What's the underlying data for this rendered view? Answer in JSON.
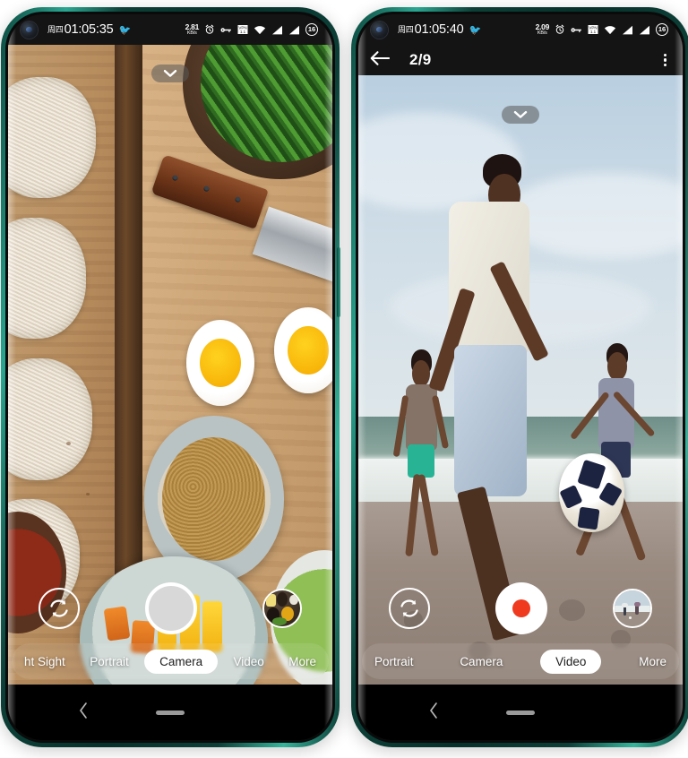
{
  "left_phone": {
    "status_bar": {
      "day_label": "周四",
      "time": "01:05:35",
      "weather_icon": "bird-icon",
      "network_speed_value": "2.81",
      "network_speed_unit": "KB/s",
      "icons": [
        "alarm-icon",
        "key-icon",
        "vpn-icon",
        "wifi-icon",
        "signal-sim1-icon",
        "signal-sim2-icon"
      ],
      "battery_level": "16"
    },
    "viewfinder": {
      "collapse_label": "chevron-down-icon",
      "scene": "food-flatlay-noodles-eggs"
    },
    "controls": {
      "flip_camera": "camera-flip-icon",
      "shutter": "shutter-button",
      "thumbnail": "spices-thumbnail"
    },
    "modes": [
      {
        "label": "ht Sight",
        "selected": false
      },
      {
        "label": "Portrait",
        "selected": false
      },
      {
        "label": "Camera",
        "selected": true
      },
      {
        "label": "Video",
        "selected": false
      },
      {
        "label": "More",
        "selected": false
      }
    ],
    "nav_bar": {
      "back": "back-chevron-icon",
      "home": "home-indicator"
    }
  },
  "right_phone": {
    "status_bar": {
      "day_label": "周四",
      "time": "01:05:40",
      "weather_icon": "bird-icon",
      "network_speed_value": "2.09",
      "network_speed_unit": "KB/s",
      "icons": [
        "alarm-icon",
        "key-icon",
        "vpn-icon",
        "wifi-icon",
        "signal-sim1-icon",
        "signal-sim2-icon"
      ],
      "battery_level": "16"
    },
    "header": {
      "back_icon": "arrow-left-icon",
      "title": "2/9",
      "overflow_icon": "kebab-menu-icon"
    },
    "viewfinder": {
      "collapse_label": "chevron-down-icon",
      "scene": "beach-soccer-players"
    },
    "controls": {
      "flip_camera": "camera-flip-icon",
      "record": "record-button",
      "thumbnail": "beach-thumbnail"
    },
    "modes": [
      {
        "label": "Portrait",
        "selected": false
      },
      {
        "label": "Camera",
        "selected": false
      },
      {
        "label": "Video",
        "selected": true
      },
      {
        "label": "More",
        "selected": false
      }
    ],
    "nav_bar": {
      "back": "back-chevron-icon",
      "home": "home-indicator"
    }
  },
  "colors": {
    "frame": "#0c3f37",
    "frame_highlight": "#2aa690",
    "status_bg": "#141414",
    "record_red": "#ef3a20",
    "selected_pill": "#ffffff"
  }
}
